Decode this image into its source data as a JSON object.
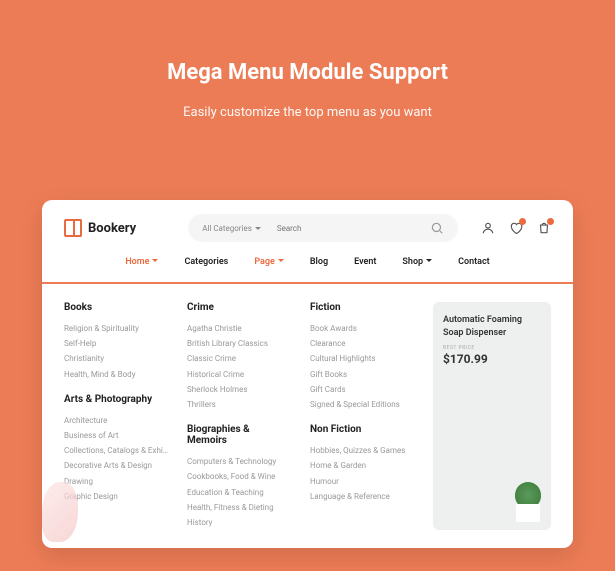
{
  "header": {
    "title": "Mega Menu Module Support",
    "subtitle": "Easily customize the top menu as you want"
  },
  "logo": {
    "text": "Bookery"
  },
  "search": {
    "category": "All Categories",
    "placeholder": "Search"
  },
  "nav": [
    {
      "label": "Home",
      "active": true,
      "arrow": true
    },
    {
      "label": "Categories",
      "active": false,
      "arrow": false
    },
    {
      "label": "Page",
      "active": true,
      "arrow": true
    },
    {
      "label": "Blog",
      "active": false,
      "arrow": false
    },
    {
      "label": "Event",
      "active": false,
      "arrow": false
    },
    {
      "label": "Shop",
      "active": false,
      "arrow": true
    },
    {
      "label": "Contact",
      "active": false,
      "arrow": false
    }
  ],
  "cols": [
    {
      "h1": "Books",
      "l1": [
        "Religion & Spirituality",
        "Self-Help",
        "Christianity",
        "Health, Mind & Body"
      ],
      "h2": "Arts & Photography",
      "l2": [
        "Architecture",
        "Business of Art",
        "Collections, Catalogs & Exhibitions",
        "Decorative Arts & Design",
        "Drawing",
        "Graphic Design"
      ]
    },
    {
      "h1": "Crime",
      "l1": [
        "Agatha Christie",
        "British Library Classics",
        "Classic Crime",
        "Historical Crime",
        "Sherlock Holmes",
        "Thrillers"
      ],
      "h2": "Biographies & Memoirs",
      "l2": [
        "Computers & Technology",
        "Cookbooks, Food & Wine",
        "Education & Teaching",
        "Health, Fitness & Dieting",
        "History"
      ]
    },
    {
      "h1": "Fiction",
      "l1": [
        "Book Awards",
        "Clearance",
        "Cultural Highlights",
        "Gift Books",
        "Gift Cards",
        "Signed & Special Editions"
      ],
      "h2": "Non Fiction",
      "l2": [
        "Hobbies, Quizzes & Games",
        "Home & Garden",
        "Humour",
        "Language & Reference"
      ]
    }
  ],
  "promo": {
    "title": "Automatic Foaming Soap Dispenser",
    "label": "BEST PRICE",
    "price": "$170.99"
  }
}
